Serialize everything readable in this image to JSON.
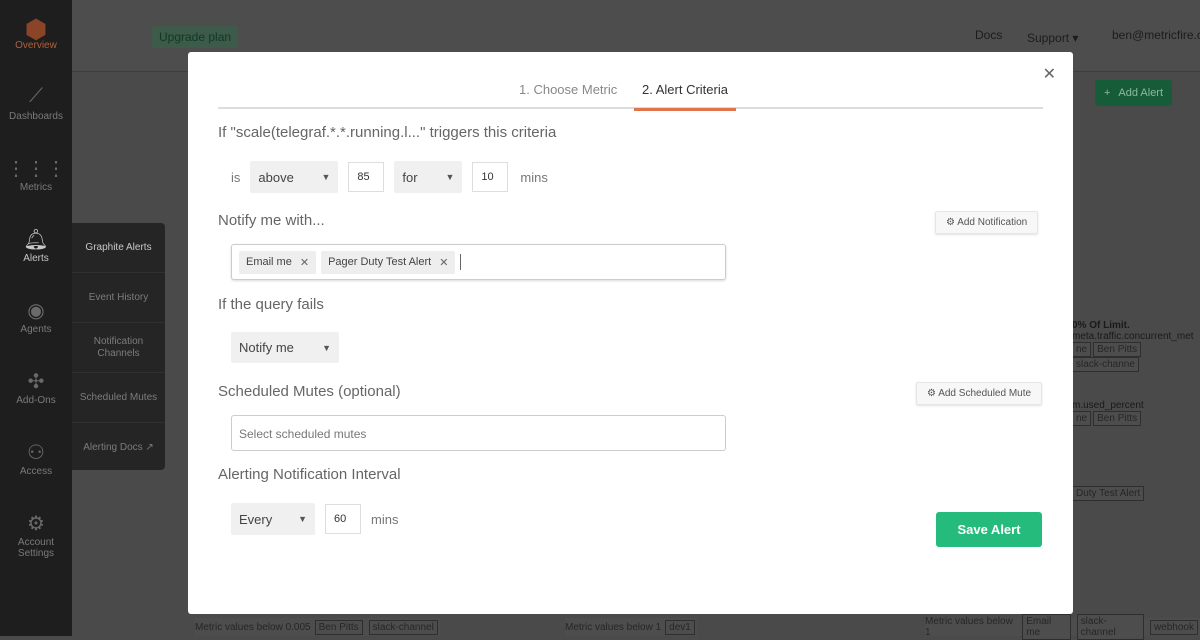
{
  "sidebar": {
    "items": [
      {
        "label": "Overview",
        "icon": "logo-icon"
      },
      {
        "label": "Dashboards",
        "icon": "chart-line-icon"
      },
      {
        "label": "Metrics",
        "icon": "sliders-icon"
      },
      {
        "label": "Alerts",
        "icon": "bell-icon"
      },
      {
        "label": "Agents",
        "icon": "eye-icon"
      },
      {
        "label": "Add-Ons",
        "icon": "puzzle-icon"
      },
      {
        "label": "Access",
        "icon": "users-icon"
      },
      {
        "label": "Account Settings",
        "icon": "gear-icon"
      }
    ],
    "flyout": [
      "Graphite Alerts",
      "Event History",
      "Notification Channels",
      "Scheduled Mutes",
      "Alerting Docs ↗"
    ]
  },
  "topbar": {
    "upgrade": "Upgrade plan",
    "docs": "Docs",
    "support": "Support ▾",
    "user": "ben@metricfire.c"
  },
  "background": {
    "add_alert": "Add Alert",
    "rows": [
      {
        "title": "0% Of Limit.",
        "query": "meta.traffic.concurrent_met",
        "tags": [
          "ne",
          "Ben Pitts",
          "slack-channe"
        ]
      },
      {
        "title": "",
        "query": "m.used_percent",
        "tags": [
          "ne",
          "Ben Pitts"
        ]
      },
      {
        "title": "",
        "query": "",
        "tags": [
          "Duty Test Alert"
        ]
      }
    ],
    "bottom": [
      {
        "text": "Metric values below 0.005",
        "tags": [
          "Ben Pitts",
          "slack-channel"
        ]
      },
      {
        "text": "Metric values below 1",
        "tags": [
          "dev1"
        ]
      },
      {
        "text": "Metric values below 1",
        "tags": [
          "Email me",
          "slack-channel",
          "webhook"
        ]
      }
    ]
  },
  "modal": {
    "tabs": [
      "1. Choose Metric",
      "2. Alert Criteria"
    ],
    "active_tab": "2. Alert Criteria",
    "criteria_heading": "If \"scale(telegraf.*.*.running.l...\" triggers this criteria",
    "is_label": "is",
    "comparator": "above",
    "threshold": "85",
    "duration_mode": "for",
    "duration": "10",
    "mins": "mins",
    "notify_heading": "Notify me with...",
    "add_notification": "Add Notification",
    "notifications": [
      "Email me",
      "Pager Duty Test Alert"
    ],
    "query_fail_heading": "If the query fails",
    "query_fail_action": "Notify me",
    "mutes_heading": "Scheduled Mutes (optional)",
    "add_mute": "Add Scheduled Mute",
    "mutes_placeholder": "Select scheduled mutes",
    "interval_heading": "Alerting Notification Interval",
    "interval_mode": "Every",
    "interval": "60",
    "interval_unit": "mins",
    "save": "Save Alert"
  },
  "colors": {
    "accent": "#e2744b",
    "save": "#24bb7c"
  }
}
